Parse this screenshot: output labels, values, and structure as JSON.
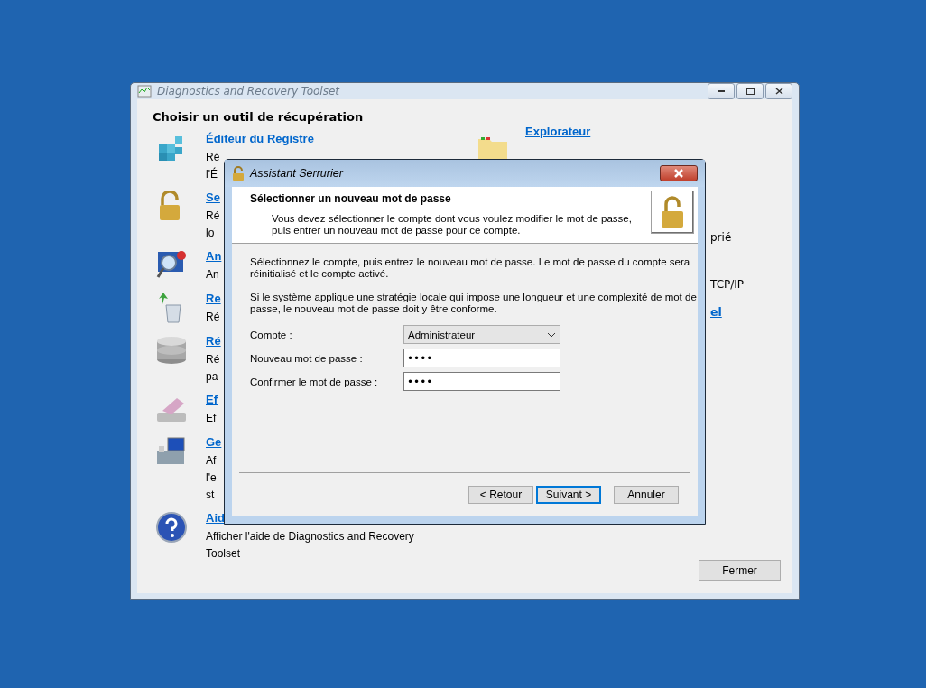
{
  "main_window": {
    "title": "Diagnostics and Recovery Toolset",
    "heading": "Choisir un outil de récupération",
    "tools_left": [
      {
        "kind": "registry",
        "title": "Éditeur du Registre",
        "description": [
          "Ré",
          "l'É"
        ]
      },
      {
        "kind": "lock",
        "title": "Se",
        "description": [
          "Ré",
          "lo"
        ]
      },
      {
        "kind": "magnifier",
        "title": "An",
        "description": [
          "An"
        ]
      },
      {
        "kind": "recycle",
        "title": "Re",
        "description": [
          "Ré"
        ]
      },
      {
        "kind": "disks",
        "title": "Ré",
        "description": [
          "Ré",
          "pa"
        ]
      },
      {
        "kind": "eraser",
        "title": "Ef",
        "description": [
          "Ef"
        ]
      },
      {
        "kind": "toolbox",
        "title": "Ge",
        "description": [
          "Af",
          "l'e",
          "st"
        ]
      },
      {
        "kind": "help",
        "title": "Aid",
        "description": [
          "Afficher l'aide de Diagnostics and Recovery",
          "Toolset"
        ]
      }
    ],
    "tools_right": [
      {
        "kind": "folder",
        "title": "Explorateur"
      }
    ],
    "fragments": [
      {
        "kind": "text",
        "text": "prié"
      },
      {
        "kind": "text",
        "text": "TCP/IP"
      },
      {
        "kind": "link",
        "text": "el"
      }
    ],
    "close_button": "Fermer"
  },
  "dialog": {
    "title": "Assistant Serrurier",
    "heading": "Sélectionner un nouveau mot de passe",
    "subtitle": [
      "Vous devez sélectionner le compte dont vous voulez modifier le mot de passe,",
      "puis entrer un nouveau mot de passe pour ce compte."
    ],
    "paragraphs": [
      [
        "Sélectionnez le compte, puis entrez le nouveau mot de passe. Le mot de passe du compte sera",
        "réinitialisé et le compte activé."
      ],
      [
        "Si le système applique une stratégie locale qui impose une longueur et une complexité de mot de",
        "passe, le nouveau mot de passe doit y être conforme."
      ]
    ],
    "fields": [
      {
        "kind": "dropdown",
        "label": "Compte :",
        "value": "Administrateur"
      },
      {
        "kind": "password",
        "label": "Nouveau mot de passe :",
        "value": "••••"
      },
      {
        "kind": "password",
        "label": "Confirmer le mot de passe :",
        "value": "••••"
      }
    ],
    "buttons": [
      {
        "label": "< Retour",
        "focused": false
      },
      {
        "label": "Suivant >",
        "focused": true
      },
      {
        "label": "Annuler",
        "focused": false
      }
    ]
  }
}
